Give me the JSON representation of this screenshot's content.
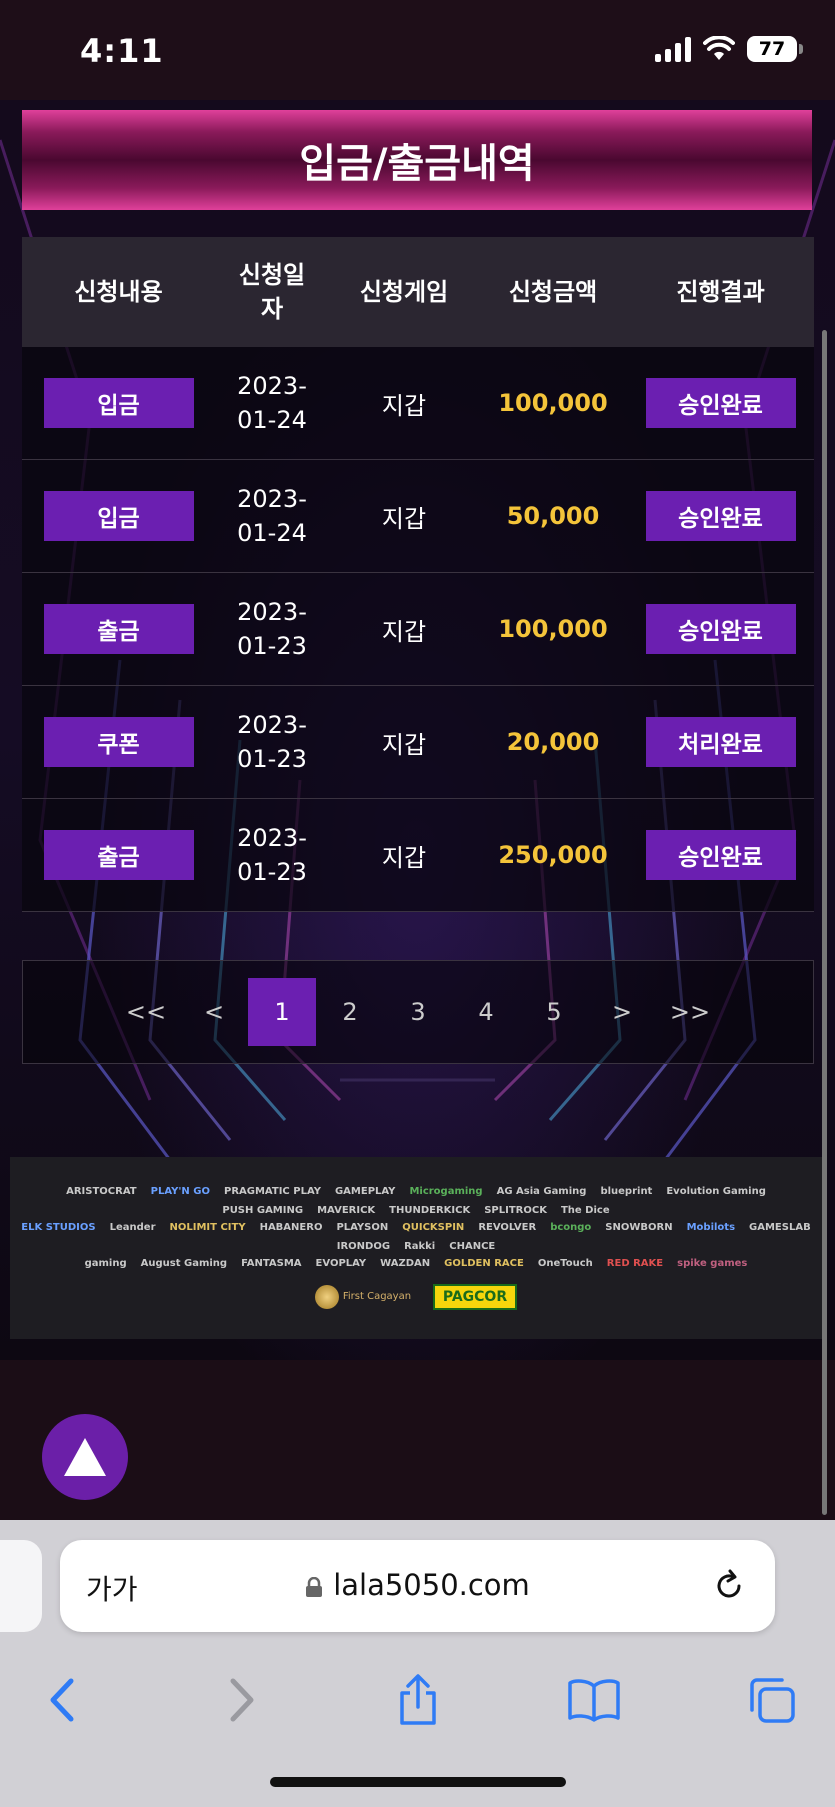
{
  "status": {
    "time": "4:11",
    "battery": "77"
  },
  "header": {
    "title": "입금/출금내역"
  },
  "table": {
    "columns": [
      "신청내용",
      "신청일자",
      "신청게임",
      "신청금액",
      "진행결과"
    ],
    "rows": [
      {
        "type": "입금",
        "date": "2023-01-24",
        "game": "지갑",
        "amount": "100,000",
        "result": "승인완료"
      },
      {
        "type": "입금",
        "date": "2023-01-24",
        "game": "지갑",
        "amount": "50,000",
        "result": "승인완료"
      },
      {
        "type": "출금",
        "date": "2023-01-23",
        "game": "지갑",
        "amount": "100,000",
        "result": "승인완료"
      },
      {
        "type": "쿠폰",
        "date": "2023-01-23",
        "game": "지갑",
        "amount": "20,000",
        "result": "처리완료"
      },
      {
        "type": "출금",
        "date": "2023-01-23",
        "game": "지갑",
        "amount": "250,000",
        "result": "승인완료"
      }
    ]
  },
  "pagination": {
    "first": "<<",
    "prev": "<",
    "pages": [
      "1",
      "2",
      "3",
      "4",
      "5"
    ],
    "active": "1",
    "next": ">",
    "last": ">>"
  },
  "providers": {
    "row1": [
      "ARISTOCRAT",
      "PLAY'N GO",
      "PRAGMATIC PLAY",
      "GAMEPLAY",
      "Microgaming",
      "AG Asia Gaming",
      "blueprint",
      "Evolution Gaming",
      "PUSH GAMING",
      "MAVERICK",
      "THUNDERKICK",
      "SPLITROCK",
      "The Dice"
    ],
    "row2": [
      "ELK STUDIOS",
      "Leander",
      "NOLIMIT CITY",
      "HABANERO",
      "PLAYSON",
      "QUICKSPIN",
      "REVOLVER",
      "bcongo",
      "SNOWBORN",
      "Mobilots",
      "GAMESLAB",
      "IRONDOG",
      "Rakki",
      "CHANCE"
    ],
    "row3": [
      "gaming",
      "August Gaming",
      "FANTASMA",
      "EVOPLAY",
      "WAZDAN",
      "GOLDEN RACE",
      "OneTouch",
      "RED RAKE",
      "spike games"
    ],
    "cert1": "First Cagayan",
    "cert2": "PAGCOR"
  },
  "browser": {
    "aa": "가가",
    "url": "lala5050.com"
  }
}
